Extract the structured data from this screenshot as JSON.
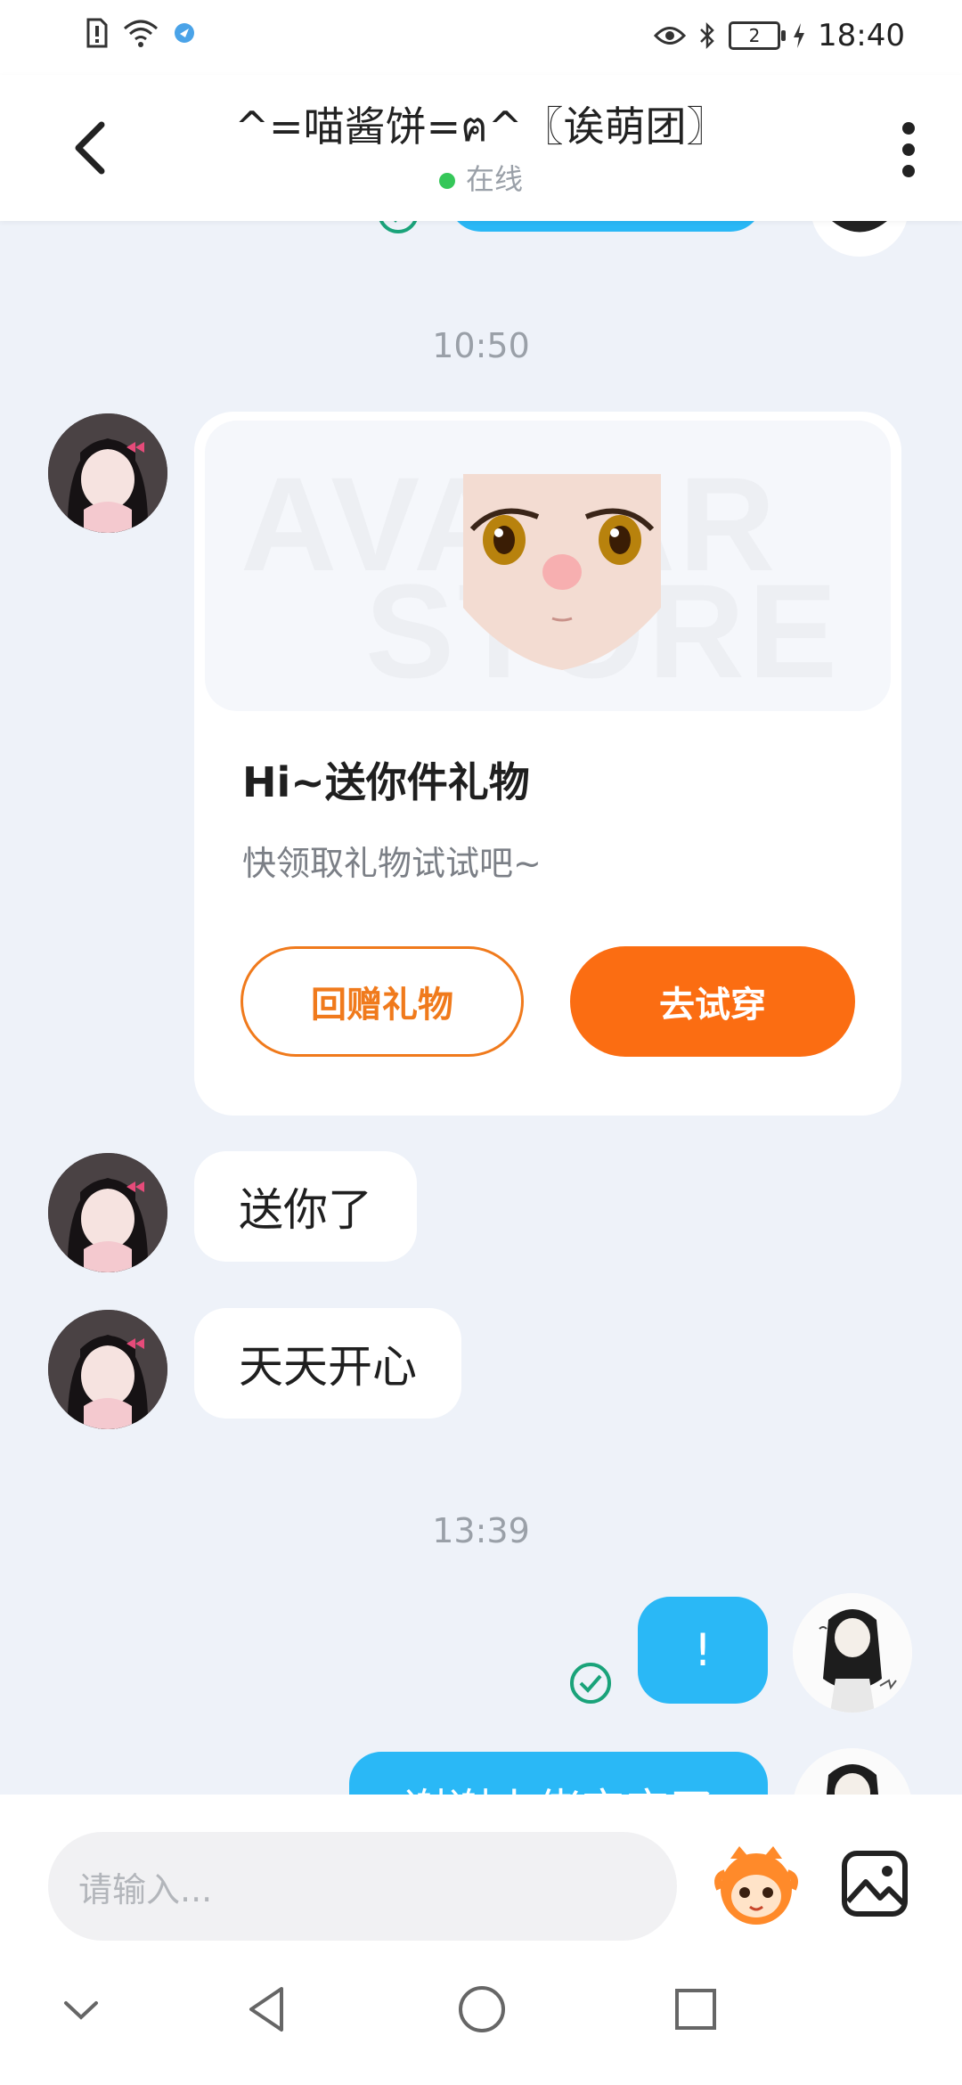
{
  "status": {
    "time": "18:40",
    "battery": "2"
  },
  "header": {
    "title": "^=喵酱饼=ฅ^〖诶萌团〗",
    "status": "在线"
  },
  "messages": {
    "time_1": "10:50",
    "gift_card": {
      "image_watermark_1": "AVATAR",
      "image_watermark_2": "STORE",
      "title": "Hi~送你件礼物",
      "subtitle": "快领取礼物试试吧~",
      "return_gift_label": "回赠礼物",
      "try_on_label": "去试穿"
    },
    "msg_1": "送你了",
    "msg_2": "天天开心",
    "time_2": "13:39",
    "out_1": "!",
    "out_2": "谢谢小佬宝宝了"
  },
  "input": {
    "placeholder": "请输入..."
  },
  "icons": {
    "back": "back-arrow-icon",
    "more": "more-vertical-icon",
    "emoji": "emoji-mascot-icon",
    "image": "image-icon"
  },
  "colors": {
    "accent_orange": "#fb6d12",
    "bubble_blue": "#2ab8f6",
    "online_green": "#35c759",
    "read_check": "#1aa37a"
  }
}
